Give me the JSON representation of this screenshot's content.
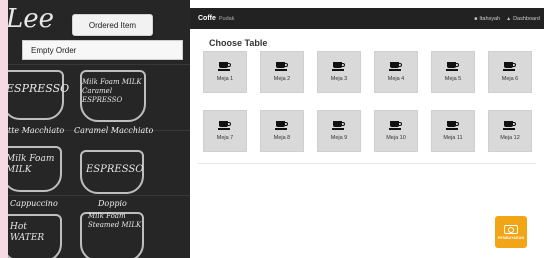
{
  "left_panel": {
    "ordered_item_button": "Ordered Item",
    "empty_order_text": "Empty Order",
    "chalkboard": {
      "header_left": "Lee",
      "cups": [
        {
          "name": "espresso",
          "text": "ESPRESSO"
        },
        {
          "name": "milk-foam",
          "text": "Milk Foam MILK Caramel ESPRESSO"
        },
        {
          "name": "latte-macchiato",
          "text": "tte Macchiato"
        },
        {
          "name": "caramel-macchiato",
          "text": "Caramel Macchiato"
        },
        {
          "name": "milk-foam-2",
          "text": "Milk Foam MILK"
        },
        {
          "name": "espresso-2",
          "text": "ESPRESSO"
        },
        {
          "name": "cappuccino",
          "text": "Cappuccino"
        },
        {
          "name": "doppio",
          "text": "Doppio"
        },
        {
          "name": "hot-water",
          "text": "Hot WATER"
        },
        {
          "name": "milk-foam-3",
          "text": "Milk Foam Steamed MILK"
        }
      ]
    }
  },
  "navbar": {
    "brand": "Coffe",
    "brand_sub": "Pudak",
    "user_label": "Itahsyah",
    "dashboard_label": "Dashboard"
  },
  "main": {
    "title": "Choose Table",
    "tables": [
      {
        "label": "Meja 1"
      },
      {
        "label": "Meja 2"
      },
      {
        "label": "Meja 3"
      },
      {
        "label": "Meja 4"
      },
      {
        "label": "Meja 5"
      },
      {
        "label": "Meja 6"
      },
      {
        "label": "Meja 7"
      },
      {
        "label": "Meja 8"
      },
      {
        "label": "Meja 9"
      },
      {
        "label": "Meja 10"
      },
      {
        "label": "Meja 11"
      },
      {
        "label": "Meja 12"
      }
    ]
  },
  "payment_badge": {
    "label": "PEMBAYARAN",
    "icon": "money-icon"
  },
  "colors": {
    "navbar": "#222222",
    "card": "#d9d9d9",
    "accent": "#f2a516",
    "chalkboard": "#262626"
  }
}
